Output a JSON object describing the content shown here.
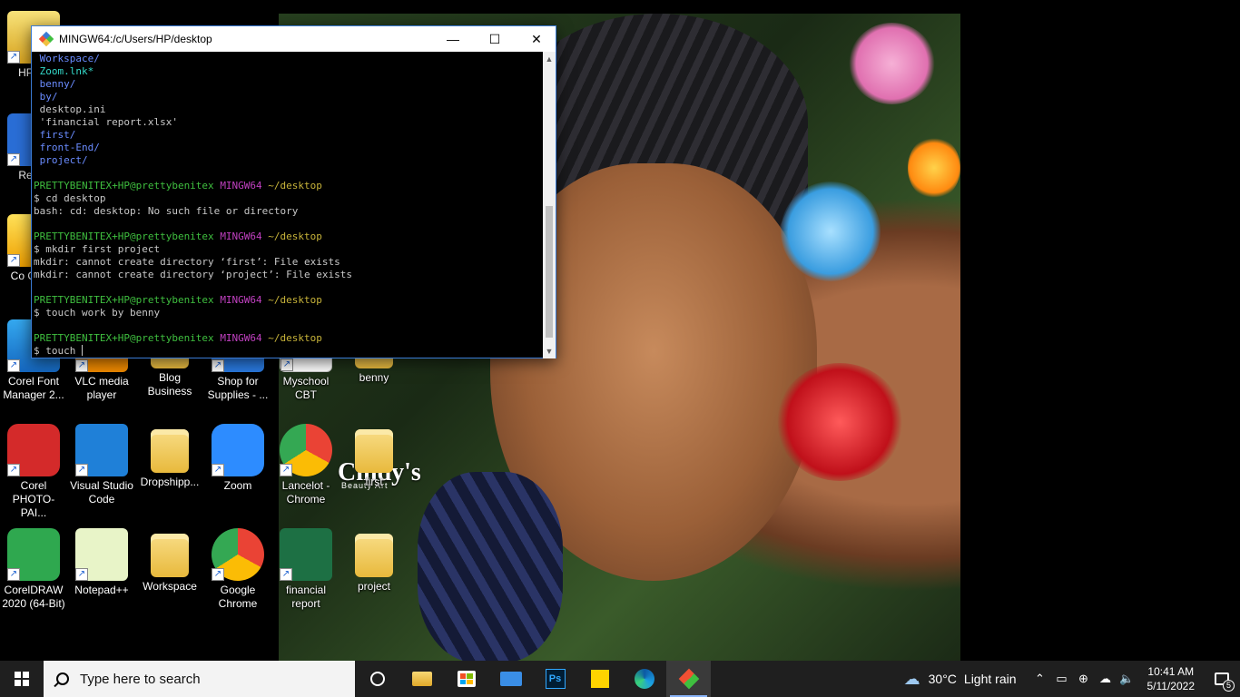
{
  "terminal": {
    "title": "MINGW64:/c/Users/HP/desktop",
    "minimize_glyph": "—",
    "maximize_glyph": "☐",
    "close_glyph": "✕",
    "prompt": {
      "user": "PRETTYBENITEX+HP@prettybenitex",
      "system": "MINGW64",
      "path": "~/desktop"
    },
    "listing": [
      {
        "text": "Workspace/",
        "kind": "dir"
      },
      {
        "text": "Zoom.lnk*",
        "kind": "link"
      },
      {
        "text": "benny/",
        "kind": "dir"
      },
      {
        "text": "by/",
        "kind": "dir"
      },
      {
        "text": "desktop.ini",
        "kind": "file"
      },
      {
        "text": "'financial report.xlsx'",
        "kind": "file"
      },
      {
        "text": "first/",
        "kind": "dir"
      },
      {
        "text": "front-End/",
        "kind": "dir"
      },
      {
        "text": "project/",
        "kind": "dir"
      }
    ],
    "commands": [
      {
        "cmd": "$ cd desktop",
        "output": [
          "bash: cd: desktop: No such file or directory"
        ]
      },
      {
        "cmd": "$ mkdir first project",
        "output": [
          "mkdir: cannot create directory ‘first’: File exists",
          "mkdir: cannot create directory ‘project’: File exists"
        ]
      },
      {
        "cmd": "$ touch work by benny",
        "output": []
      }
    ],
    "current_input": "$ touch "
  },
  "desktop_icons": [
    {
      "label": "HP Sc",
      "col": 0,
      "row": 0
    },
    {
      "label": "Recyc",
      "col": 0,
      "row": 1
    },
    {
      "label": "Co CAPT",
      "col": 0,
      "row": 2
    },
    {
      "label": "Corel Font Manager 2...",
      "col": 0,
      "row": 3
    },
    {
      "label": "VLC media player",
      "col": 1,
      "row": 3
    },
    {
      "label": "Blog Business",
      "col": 2,
      "row": 3
    },
    {
      "label": "Shop for Supplies - ...",
      "col": 3,
      "row": 3
    },
    {
      "label": "Myschool CBT",
      "col": 4,
      "row": 3
    },
    {
      "label": "benny",
      "col": 5,
      "row": 3
    },
    {
      "label": "Corel PHOTO-PAI...",
      "col": 0,
      "row": 4
    },
    {
      "label": "Visual Studio Code",
      "col": 1,
      "row": 4
    },
    {
      "label": "Dropshipp...",
      "col": 2,
      "row": 4
    },
    {
      "label": "Zoom",
      "col": 3,
      "row": 4
    },
    {
      "label": "Lancelot - Chrome",
      "col": 4,
      "row": 4
    },
    {
      "label": "first",
      "col": 5,
      "row": 4
    },
    {
      "label": "CorelDRAW 2020 (64-Bit)",
      "col": 0,
      "row": 5
    },
    {
      "label": "Notepad++",
      "col": 1,
      "row": 5
    },
    {
      "label": "Workspace",
      "col": 2,
      "row": 5
    },
    {
      "label": "Google Chrome",
      "col": 3,
      "row": 5
    },
    {
      "label": "financial report",
      "col": 4,
      "row": 5
    },
    {
      "label": "project",
      "col": 5,
      "row": 5
    }
  ],
  "wallpaper": {
    "brand": "Cindy's",
    "brand_sub": "Beauty Art"
  },
  "taskbar": {
    "search_placeholder": "Type here to search",
    "apps": [
      "task-view",
      "file-explorer",
      "microsoft-store",
      "mail",
      "photoshop",
      "sticky-notes",
      "edge",
      "git-bash"
    ],
    "weather": {
      "temp": "30°C",
      "condition": "Light rain"
    },
    "time": "10:41 AM",
    "date": "5/11/2022",
    "notification_count": "5"
  },
  "colors": {
    "terminal_bg": "#000000",
    "dir": "#6a8cff",
    "link": "#34d9c9",
    "prompt_user": "#3fbf3f",
    "prompt_system": "#c040c0",
    "prompt_path": "#c8b43a",
    "taskbar": "#1f1f1f"
  }
}
